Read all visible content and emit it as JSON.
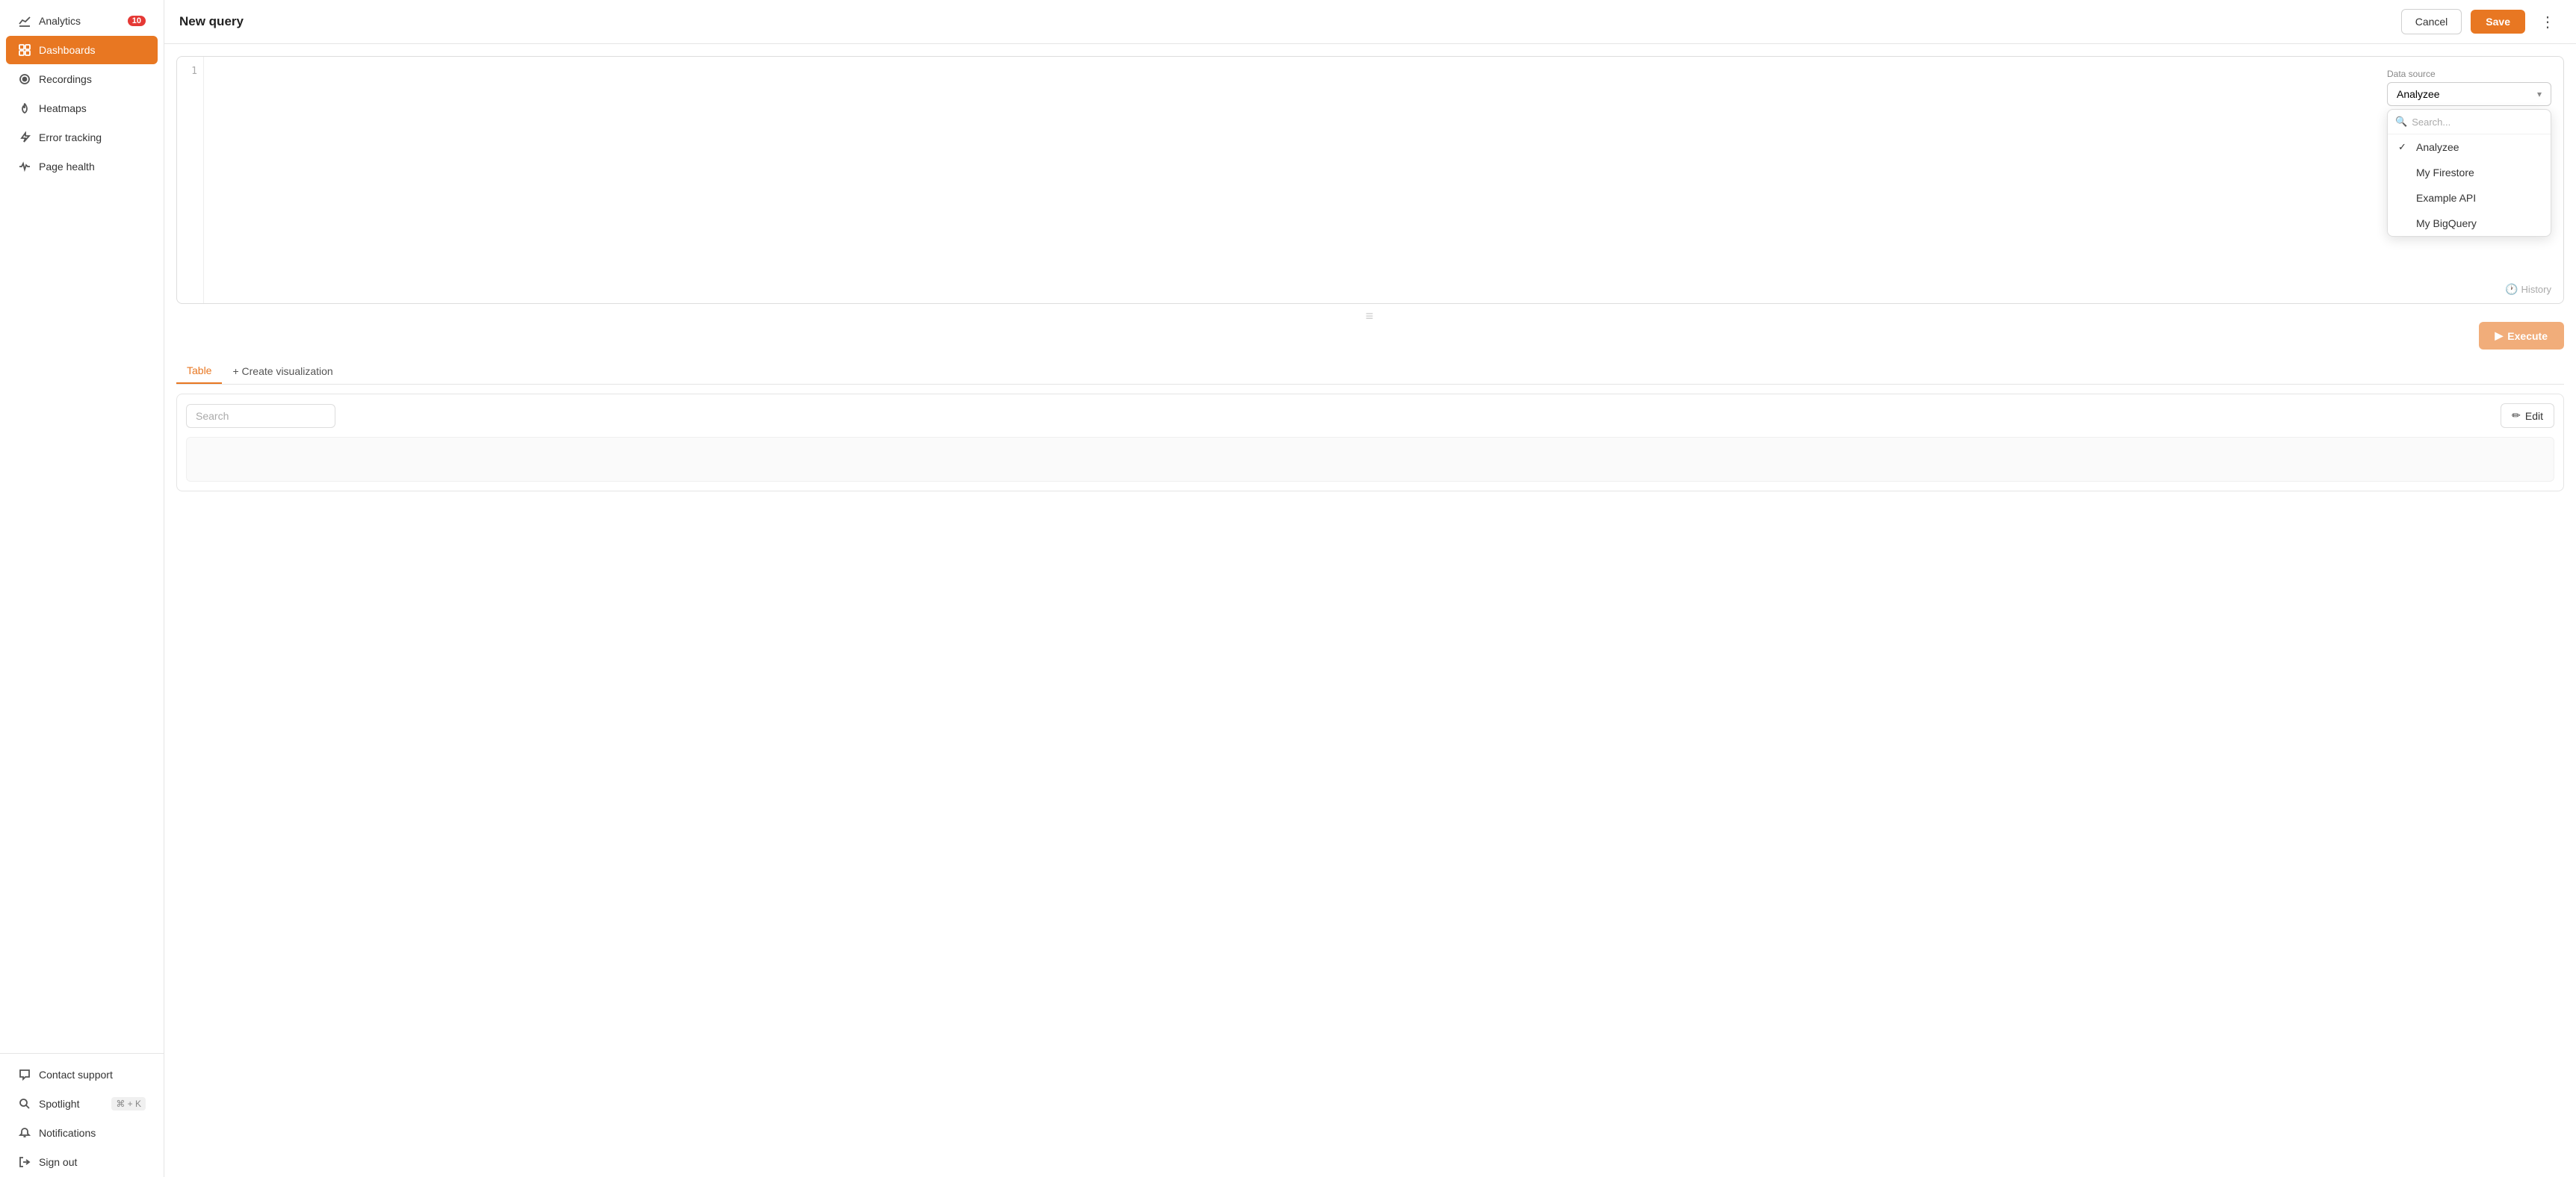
{
  "sidebar": {
    "items": [
      {
        "id": "analytics",
        "label": "Analytics",
        "icon": "chart",
        "badge": "10",
        "active": false
      },
      {
        "id": "dashboards",
        "label": "Dashboards",
        "icon": "grid",
        "active": true
      },
      {
        "id": "recordings",
        "label": "Recordings",
        "icon": "circle",
        "active": false
      },
      {
        "id": "heatmaps",
        "label": "Heatmaps",
        "icon": "flame",
        "active": false
      },
      {
        "id": "error-tracking",
        "label": "Error tracking",
        "icon": "lightning",
        "active": false
      },
      {
        "id": "page-health",
        "label": "Page health",
        "icon": "pulse",
        "active": false
      }
    ],
    "bottom_items": [
      {
        "id": "contact-support",
        "label": "Contact support",
        "icon": "chat"
      },
      {
        "id": "spotlight",
        "label": "Spotlight",
        "icon": "search",
        "shortcut": "⌘ + K"
      },
      {
        "id": "notifications",
        "label": "Notifications",
        "icon": "bell"
      },
      {
        "id": "sign-out",
        "label": "Sign out",
        "icon": "signout"
      }
    ]
  },
  "header": {
    "title": "New query",
    "cancel_label": "Cancel",
    "save_label": "Save",
    "more_icon": "⋮"
  },
  "editor": {
    "line_number": "1",
    "placeholder": ""
  },
  "datasource": {
    "label": "Data source",
    "selected": "Analyzee",
    "search_placeholder": "Search...",
    "options": [
      {
        "label": "Analyzee",
        "selected": true
      },
      {
        "label": "My Firestore",
        "selected": false
      },
      {
        "label": "Example API",
        "selected": false
      },
      {
        "label": "My BigQuery",
        "selected": false
      }
    ]
  },
  "history": {
    "label": "History"
  },
  "execute": {
    "label": "Execute"
  },
  "tabs": [
    {
      "label": "Table",
      "active": true
    },
    {
      "label": "+ Create visualization",
      "active": false
    }
  ],
  "results": {
    "search_placeholder": "Search",
    "edit_label": "Edit"
  }
}
